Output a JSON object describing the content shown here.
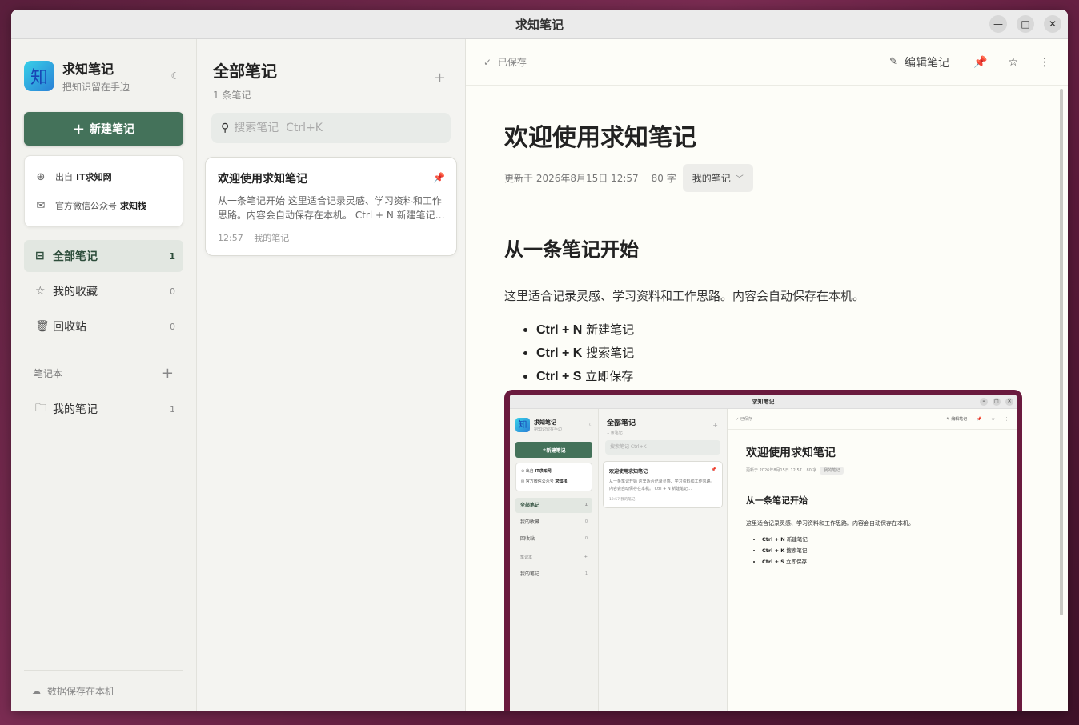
{
  "window": {
    "title": "求知笔记",
    "controls": {
      "minimize": "—",
      "maximize": "□",
      "close": "✕"
    }
  },
  "sidebar": {
    "app_name": "求知笔记",
    "tagline": "把知识留在手边",
    "new_note_label": "新建笔记",
    "info": [
      {
        "prefix": "出自",
        "name": "IT求知网",
        "icon": "globe-icon"
      },
      {
        "prefix": "官方微信公众号",
        "name": "求知栈",
        "icon": "wechat-icon"
      }
    ],
    "nav": [
      {
        "label": "全部笔记",
        "count": "1",
        "icon": "inbox-icon"
      },
      {
        "label": "我的收藏",
        "count": "0",
        "icon": "star-icon"
      },
      {
        "label": "回收站",
        "count": "0",
        "icon": "trash-icon"
      }
    ],
    "notebooks_heading": "笔记本",
    "notebooks": [
      {
        "label": "我的笔记",
        "count": "1",
        "icon": "folder-icon"
      }
    ],
    "footer": "数据保存在本机"
  },
  "list": {
    "title": "全部笔记",
    "count": "1 条笔记",
    "search_placeholder": "搜索笔记  Ctrl+K",
    "notes": [
      {
        "title": "欢迎使用求知笔记",
        "excerpt": "从一条笔记开始 这里适合记录灵感、学习资料和工作思路。内容会自动保存在本机。 Ctrl + N 新建笔记…",
        "time": "12:57",
        "notebook": "我的笔记",
        "pinned": true
      }
    ]
  },
  "editor": {
    "saved_status": "已保存",
    "edit_label": "编辑笔记",
    "doc": {
      "title": "欢迎使用求知笔记",
      "updated": "更新于 2026年8月15日 12:57",
      "word_count": "80 字",
      "notebook": "我的笔记",
      "heading": "从一条笔记开始",
      "paragraph": "这里适合记录灵感、学习资料和工作思路。内容会自动保存在本机。",
      "shortcuts": [
        {
          "keys": "Ctrl + N",
          "action": "新建笔记"
        },
        {
          "keys": "Ctrl + K",
          "action": "搜索笔记"
        },
        {
          "keys": "Ctrl + S",
          "action": "立即保存"
        }
      ]
    }
  },
  "colors": {
    "accent": "#44725a",
    "pin": "#2d6a4a",
    "desktop": "#6a1a3e"
  }
}
